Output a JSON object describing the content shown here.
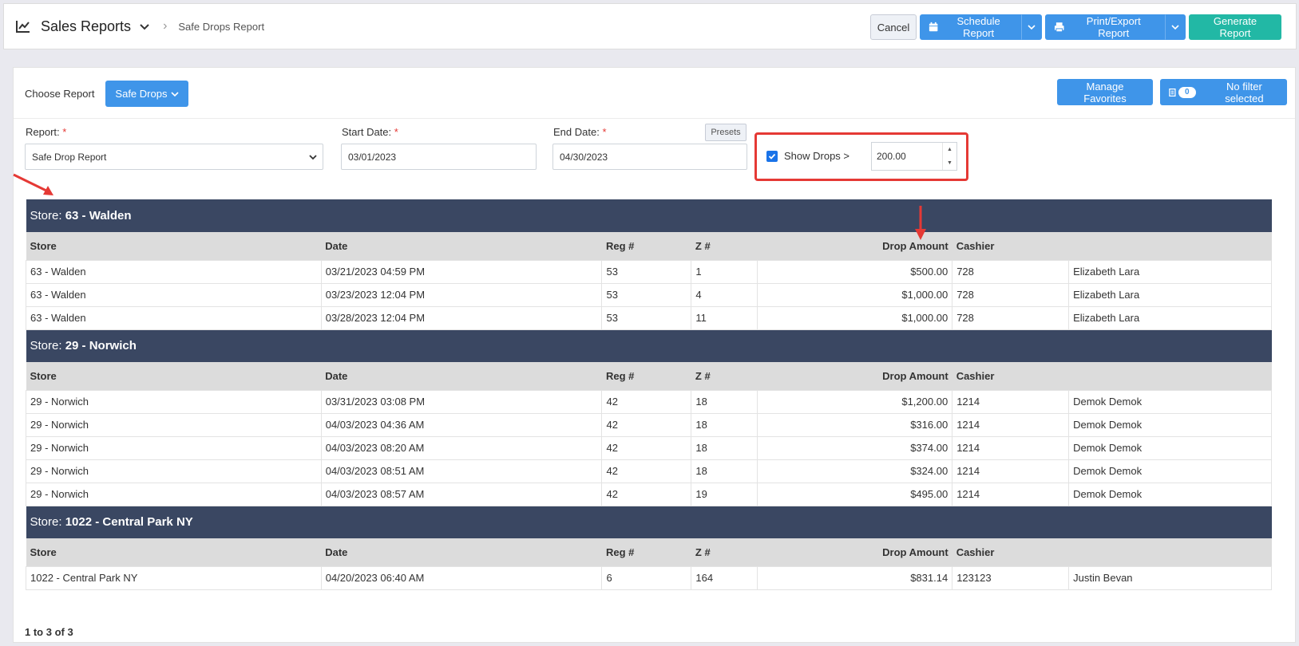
{
  "header": {
    "app_title": "Sales Reports",
    "breadcrumb_sub": "Safe Drops Report",
    "cancel_label": "Cancel",
    "schedule_label": "Schedule Report",
    "print_label": "Print/Export Report",
    "generate_label": "Generate Report"
  },
  "panel": {
    "choose_label": "Choose Report",
    "choose_value": "Safe Drops",
    "manage_favorites_label": "Manage Favorites",
    "filter_count": "0",
    "filter_label": "No filter selected"
  },
  "form": {
    "report_label": "Report:",
    "report_value": "Safe Drop Report",
    "start_label": "Start Date:",
    "start_value": "03/01/2023",
    "end_label": "End Date:",
    "end_value": "04/30/2023",
    "presets_label": "Presets",
    "show_drops_label": "Show Drops >",
    "show_drops_checked": true,
    "show_drops_value": "200.00",
    "required_mark": "*"
  },
  "table": {
    "columns": [
      "Store",
      "Date",
      "Reg #",
      "Z #",
      "Drop Amount",
      "Cashier",
      ""
    ],
    "store_prefix": "Store:",
    "groups": [
      {
        "store": "63 - Walden",
        "rows": [
          [
            "63 - Walden",
            "03/21/2023 04:59 PM",
            "53",
            "1",
            "$500.00",
            "728",
            "Elizabeth Lara"
          ],
          [
            "63 - Walden",
            "03/23/2023 12:04 PM",
            "53",
            "4",
            "$1,000.00",
            "728",
            "Elizabeth Lara"
          ],
          [
            "63 - Walden",
            "03/28/2023 12:04 PM",
            "53",
            "11",
            "$1,000.00",
            "728",
            "Elizabeth Lara"
          ]
        ]
      },
      {
        "store": "29 - Norwich",
        "rows": [
          [
            "29 - Norwich",
            "03/31/2023 03:08 PM",
            "42",
            "18",
            "$1,200.00",
            "1214",
            "Demok Demok"
          ],
          [
            "29 - Norwich",
            "04/03/2023 04:36 AM",
            "42",
            "18",
            "$316.00",
            "1214",
            "Demok Demok"
          ],
          [
            "29 - Norwich",
            "04/03/2023 08:20 AM",
            "42",
            "18",
            "$374.00",
            "1214",
            "Demok Demok"
          ],
          [
            "29 - Norwich",
            "04/03/2023 08:51 AM",
            "42",
            "18",
            "$324.00",
            "1214",
            "Demok Demok"
          ],
          [
            "29 - Norwich",
            "04/03/2023 08:57 AM",
            "42",
            "19",
            "$495.00",
            "1214",
            "Demok Demok"
          ]
        ]
      },
      {
        "store": "1022 - Central Park NY",
        "rows": [
          [
            "1022 - Central Park NY",
            "04/20/2023 06:40 AM",
            "6",
            "164",
            "$831.14",
            "123123",
            "Justin Bevan"
          ]
        ]
      }
    ],
    "pager": "1 to 3 of 3"
  },
  "colors": {
    "primary": "#3f95e9",
    "success": "#22b8a5",
    "store_header": "#3a4762",
    "annotation": "#e53935"
  }
}
